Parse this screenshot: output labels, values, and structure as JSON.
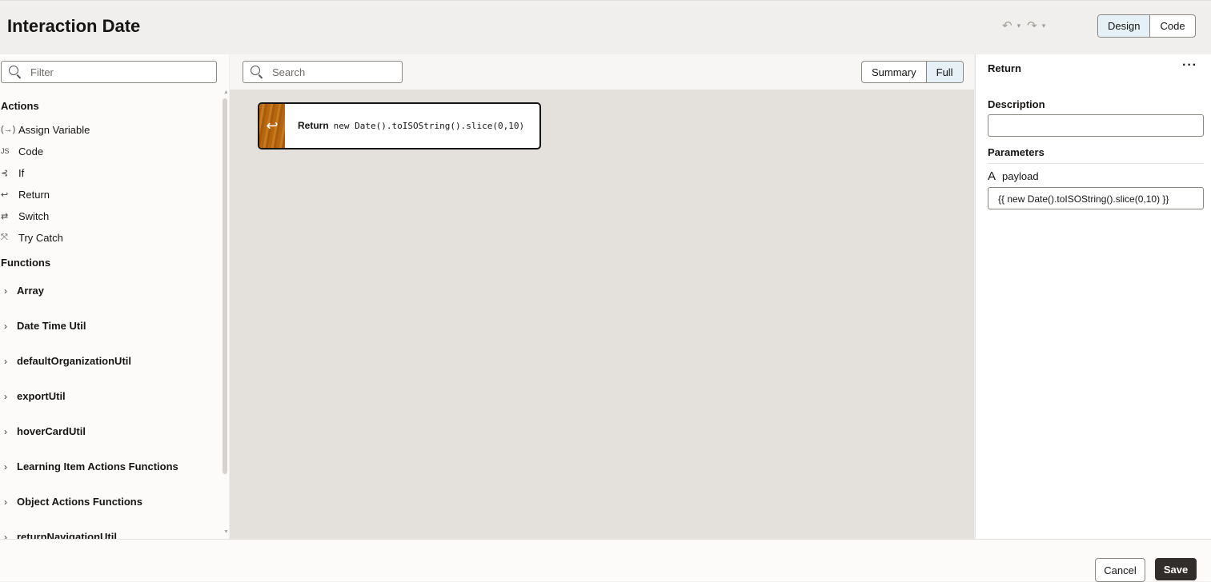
{
  "header": {
    "title": "Interaction Date",
    "undo_icon": "undo-icon",
    "redo_icon": "redo-icon",
    "view_modes": [
      "Design",
      "Code"
    ],
    "selected_view": "Design"
  },
  "sidebar": {
    "filter_placeholder": "Filter",
    "actions_heading": "Actions",
    "actions": [
      {
        "icon": "(→)",
        "label": "Assign Variable"
      },
      {
        "icon": "JS",
        "label": "Code"
      },
      {
        "icon": "⊰",
        "label": "If"
      },
      {
        "icon": "↩",
        "label": "Return"
      },
      {
        "icon": "⇄",
        "label": "Switch"
      },
      {
        "icon": "⤧",
        "label": "Try Catch"
      }
    ],
    "functions_heading": "Functions",
    "functions": [
      "Array",
      "Date Time Util",
      "defaultOrganizationUtil",
      "exportUtil",
      "hoverCardUtil",
      "Learning Item Actions Functions",
      "Object Actions Functions",
      "returnNavigationUtil"
    ]
  },
  "canvas": {
    "search_placeholder": "Search",
    "detail_modes": [
      "Summary",
      "Full"
    ],
    "selected_detail": "Full",
    "node": {
      "icon": "↩",
      "label": "Return",
      "expression": "new Date().toISOString().slice(0,10)"
    }
  },
  "properties": {
    "title": "Return",
    "more_label": "···",
    "description_label": "Description",
    "description_value": "",
    "parameters_label": "Parameters",
    "param_name": "payload",
    "param_type_icon": "A",
    "param_value": "{{ new Date().toISOString().slice(0,10) }}"
  },
  "footer": {
    "cancel_label": "Cancel",
    "save_label": "Save"
  }
}
